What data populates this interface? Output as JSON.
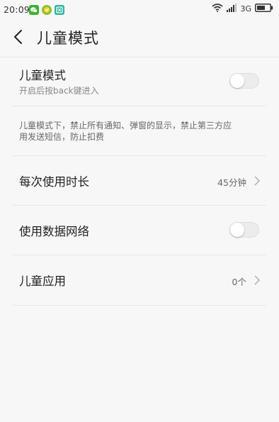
{
  "status_bar": {
    "time": "20:09",
    "network": "3G",
    "app_icons": [
      "wechat-icon",
      "app-icon-yellow",
      "app-icon-teal"
    ],
    "colors": {
      "wechat": "#3cb034",
      "yellow": "#8fbf2a",
      "teal": "#2bb3a0"
    }
  },
  "header": {
    "title": "儿童模式"
  },
  "kid_mode": {
    "title": "儿童模式",
    "subtitle": "开启后按back键进入",
    "enabled": false
  },
  "description": {
    "text_line1": "儿童模式下，禁止所有通知、弹窗的显示，禁止第三方应",
    "text_line2": "用发送短信，防止扣费"
  },
  "usage_time": {
    "title": "每次使用时长",
    "value": "45分钟"
  },
  "mobile_data": {
    "title": "使用数据网络",
    "enabled": false
  },
  "kid_apps": {
    "title": "儿童应用",
    "value": "0个"
  }
}
